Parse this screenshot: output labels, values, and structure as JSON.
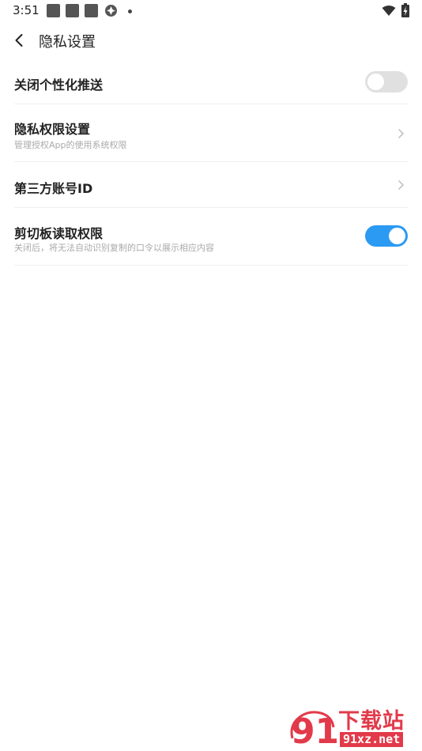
{
  "status_bar": {
    "time": "3:51",
    "icons": [
      "notification-square-icon",
      "notification-square-icon",
      "notification-square-icon",
      "aperture-icon",
      "dot-icon",
      "wifi-icon",
      "battery-charging-icon"
    ]
  },
  "header": {
    "back_icon": "chevron-left-icon",
    "title": "隐私设置"
  },
  "settings": [
    {
      "title": "关闭个性化推送",
      "description": "",
      "control": "toggle",
      "on": false
    },
    {
      "title": "隐私权限设置",
      "description": "管理授权App的使用系统权限",
      "control": "chevron"
    },
    {
      "title": "第三方账号ID",
      "description": "",
      "control": "chevron"
    },
    {
      "title": "剪切板读取权限",
      "description": "关闭后，将无法自动识别复制的口令以展示相应内容",
      "control": "toggle",
      "on": true
    }
  ],
  "watermark": {
    "logo_text": "91",
    "cn_text": "下载站",
    "en_text": "91xz.net"
  },
  "colors": {
    "accent": "#2b9af3",
    "toggle_off": "#e0e0e0",
    "divider": "#efefef",
    "watermark": "#e23a4a"
  }
}
